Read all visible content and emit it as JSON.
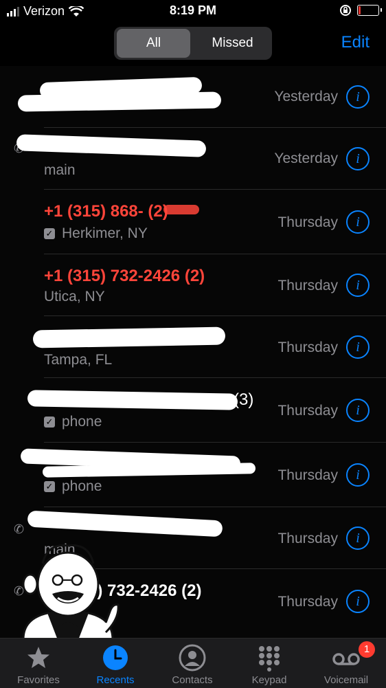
{
  "status_bar": {
    "carrier": "Verizon",
    "time": "8:19 PM"
  },
  "segmented": {
    "all_label": "All",
    "missed_label": "Missed"
  },
  "edit_label": "Edit",
  "calls": [
    {
      "name": "",
      "name_red": false,
      "subtitle": "",
      "show_check": false,
      "when": "Yesterday"
    },
    {
      "name": "",
      "name_red": false,
      "subtitle": "main",
      "show_check": false,
      "when": "Yesterday"
    },
    {
      "name": "+1 (315) 868-     (2)",
      "name_red": true,
      "subtitle": "Herkimer, NY",
      "show_check": true,
      "when": "Thursday"
    },
    {
      "name": "+1 (315) 732-2426 (2)",
      "name_red": true,
      "subtitle": "Utica, NY",
      "show_check": false,
      "when": "Thursday"
    },
    {
      "name": "",
      "name_red": false,
      "subtitle": "Tampa, FL",
      "show_check": false,
      "when": "Thursday"
    },
    {
      "name": "(3)",
      "name_red": false,
      "subtitle": "phone",
      "show_check": true,
      "when": "Thursday"
    },
    {
      "name": "",
      "name_red": false,
      "subtitle": "phone",
      "show_check": true,
      "when": "Thursday"
    },
    {
      "name": "",
      "name_red": false,
      "subtitle": "main",
      "show_check": false,
      "when": "Thursday"
    },
    {
      "name": "5) 732-2426 (2)",
      "name_red": false,
      "subtitle": "",
      "show_check": false,
      "when": "Thursday"
    }
  ],
  "tabs": [
    {
      "label": "Favorites",
      "icon": "star-icon"
    },
    {
      "label": "Recents",
      "icon": "clock-icon"
    },
    {
      "label": "Contacts",
      "icon": "person-circle-icon"
    },
    {
      "label": "Keypad",
      "icon": "keypad-icon"
    },
    {
      "label": "Voicemail",
      "icon": "voicemail-icon"
    }
  ],
  "voicemail_badge": "1",
  "colors": {
    "accent": "#0a84ff",
    "missed": "#ff453a",
    "badge": "#ff3b30"
  }
}
